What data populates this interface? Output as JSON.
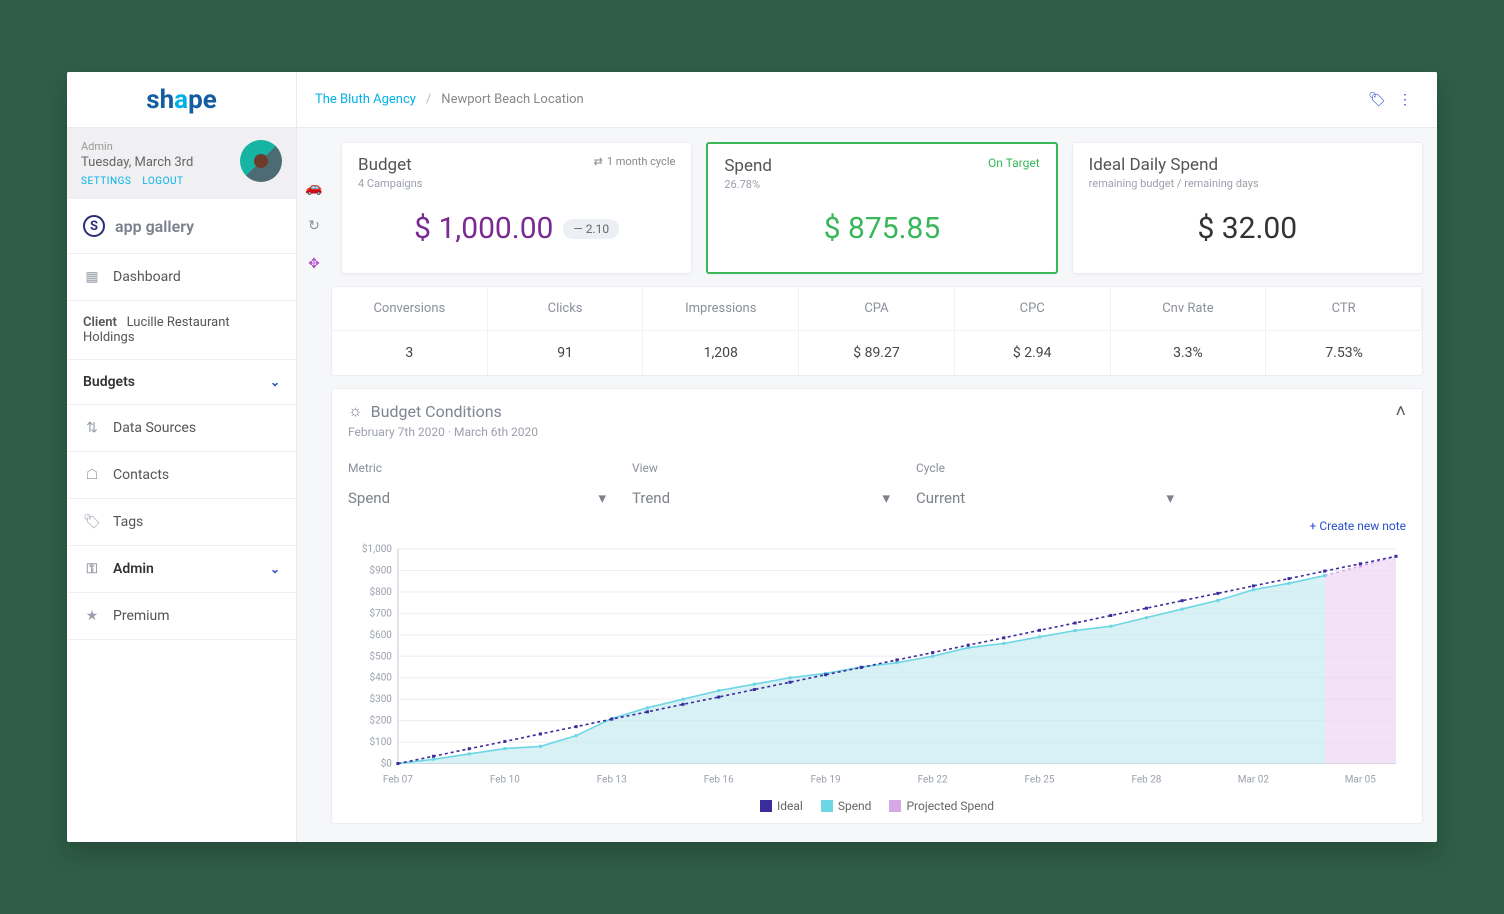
{
  "logo": {
    "pre": "sh",
    "accent": "a",
    "post": "pe"
  },
  "user": {
    "role": "Admin",
    "date": "Tuesday, March 3rd",
    "settings_label": "SETTINGS",
    "logout_label": "LOGOUT"
  },
  "app_gallery_label": "app gallery",
  "sidebar": {
    "items": [
      {
        "icon": "grid",
        "label": "Dashboard",
        "expandable": false
      },
      {
        "icon": "client",
        "label_prefix": "Client",
        "label": "Lucille Restaurant Holdings"
      },
      {
        "icon": "",
        "label": "Budgets",
        "expandable": true,
        "bold": true
      },
      {
        "icon": "datasrc",
        "label": "Data Sources",
        "expandable": false
      },
      {
        "icon": "contacts",
        "label": "Contacts",
        "expandable": false
      },
      {
        "icon": "tags",
        "label": "Tags",
        "expandable": false
      },
      {
        "icon": "admin",
        "label": "Admin",
        "expandable": true,
        "bold": true
      },
      {
        "icon": "premium",
        "label": "Premium",
        "expandable": false
      }
    ]
  },
  "breadcrumb": {
    "agency": "The Bluth Agency",
    "location": "Newport Beach Location"
  },
  "kpi": {
    "budget": {
      "title": "Budget",
      "sub": "4 Campaigns",
      "cycle": "1 month cycle",
      "value": "$ 1,000.00",
      "chip": "— 2.10"
    },
    "spend": {
      "title": "Spend",
      "sub": "26.78%",
      "status": "On Target",
      "value": "$ 875.85"
    },
    "ideal": {
      "title": "Ideal Daily Spend",
      "sub": "remaining budget / remaining days",
      "value": "$ 32.00"
    }
  },
  "metrics": {
    "headers": [
      "Conversions",
      "Clicks",
      "Impressions",
      "CPA",
      "CPC",
      "Cnv Rate",
      "CTR"
    ],
    "values": [
      "3",
      "91",
      "1,208",
      "$ 89.27",
      "$ 2.94",
      "3.3%",
      "7.53%"
    ]
  },
  "panel": {
    "title": "Budget Conditions",
    "range": "February 7th 2020  ·  March 6th 2020",
    "filters": {
      "metric_label": "Metric",
      "metric": "Spend",
      "view_label": "View",
      "view": "Trend",
      "cycle_label": "Cycle",
      "cycle": "Current"
    },
    "new_note_label": "+ Create new note",
    "legend": {
      "ideal": "Ideal",
      "spend": "Spend",
      "proj": "Projected Spend"
    }
  },
  "chart_data": {
    "type": "line",
    "title": "Budget Conditions — Spend Trend",
    "xlabel": "",
    "ylabel": "$",
    "ylim": [
      0,
      1000
    ],
    "y_ticks": [
      0,
      100,
      200,
      300,
      400,
      500,
      600,
      700,
      800,
      900,
      1000
    ],
    "x_ticks": [
      "Feb 07",
      "Feb 10",
      "Feb 13",
      "Feb 16",
      "Feb 19",
      "Feb 22",
      "Feb 25",
      "Feb 28",
      "Mar 02",
      "Mar 05"
    ],
    "categories": [
      "Feb 07",
      "Feb 08",
      "Feb 09",
      "Feb 10",
      "Feb 11",
      "Feb 12",
      "Feb 13",
      "Feb 14",
      "Feb 15",
      "Feb 16",
      "Feb 17",
      "Feb 18",
      "Feb 19",
      "Feb 20",
      "Feb 21",
      "Feb 22",
      "Feb 23",
      "Feb 24",
      "Feb 25",
      "Feb 26",
      "Feb 27",
      "Feb 28",
      "Feb 29",
      "Mar 01",
      "Mar 02",
      "Mar 03",
      "Mar 04",
      "Mar 05",
      "Mar 06"
    ],
    "series": [
      {
        "name": "Ideal",
        "color": "#3b2d9b",
        "values": [
          0,
          34,
          69,
          103,
          138,
          172,
          207,
          241,
          276,
          310,
          345,
          379,
          414,
          448,
          483,
          517,
          552,
          586,
          621,
          655,
          690,
          724,
          759,
          793,
          828,
          862,
          897,
          931,
          966
        ]
      },
      {
        "name": "Spend",
        "color": "#6dd6e5",
        "fill": "#c7ebf1",
        "values": [
          0,
          20,
          45,
          70,
          80,
          130,
          210,
          260,
          300,
          340,
          370,
          400,
          420,
          450,
          470,
          500,
          540,
          560,
          590,
          620,
          640,
          680,
          720,
          760,
          810,
          840,
          876,
          null,
          null
        ]
      },
      {
        "name": "Projected Spend",
        "color": "#d6a9e6",
        "fill": "#ecd6f3",
        "values": [
          null,
          null,
          null,
          null,
          null,
          null,
          null,
          null,
          null,
          null,
          null,
          null,
          null,
          null,
          null,
          null,
          null,
          null,
          null,
          null,
          null,
          null,
          null,
          null,
          null,
          null,
          876,
          920,
          965
        ]
      }
    ],
    "legend_position": "bottom"
  }
}
